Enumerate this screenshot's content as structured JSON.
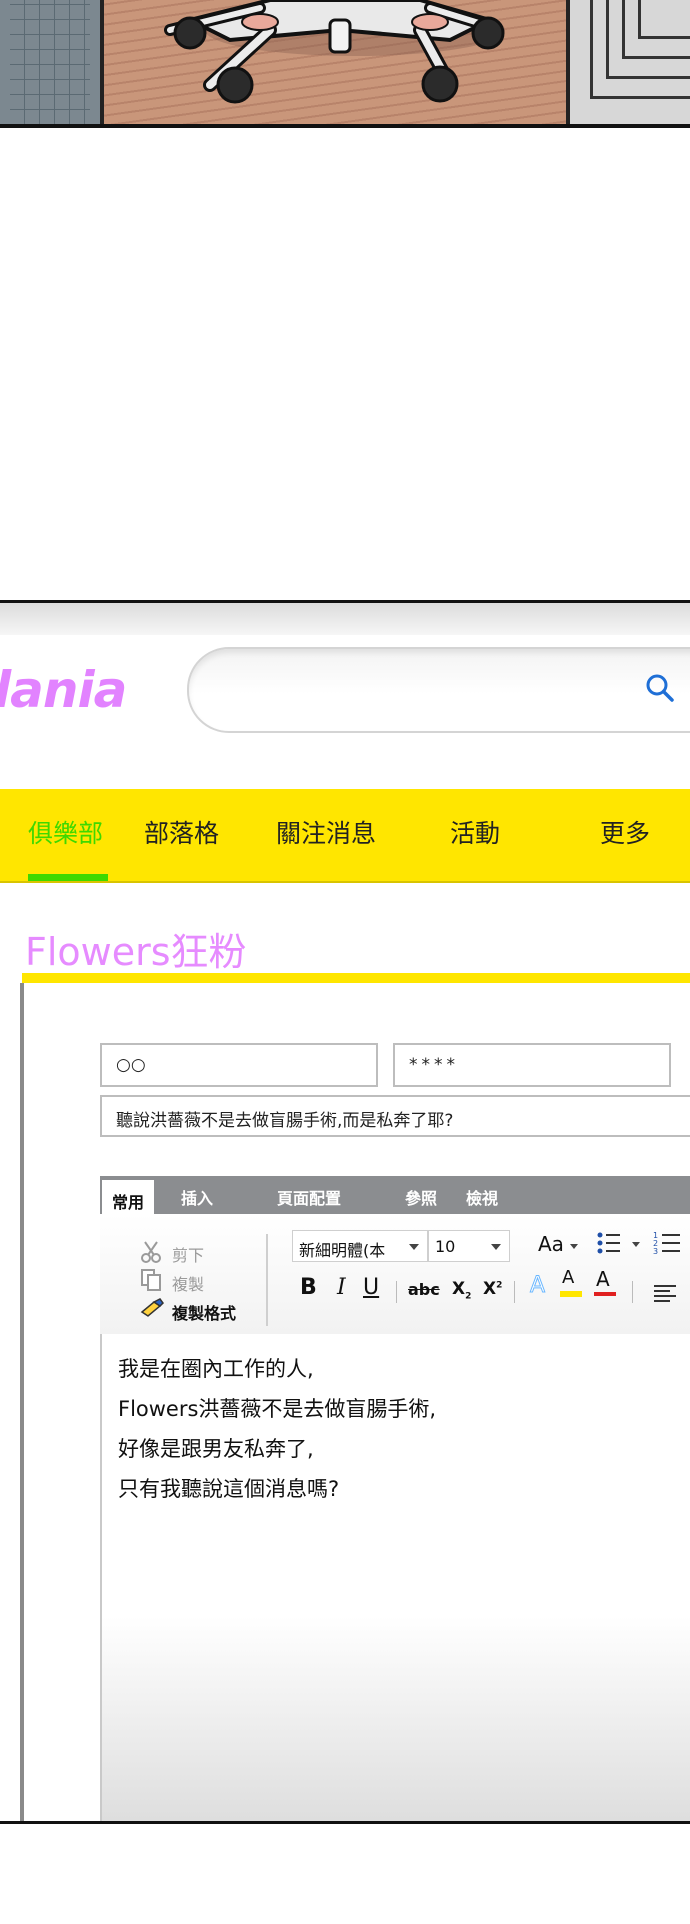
{
  "site": {
    "logo_text": "lania",
    "search_placeholder": ""
  },
  "nav": {
    "items": [
      {
        "label": "俱樂部",
        "active": true
      },
      {
        "label": "部落格",
        "active": false
      },
      {
        "label": "關注消息",
        "active": false
      },
      {
        "label": "活動",
        "active": false
      },
      {
        "label": "更多",
        "active": false
      }
    ]
  },
  "club": {
    "title": "Flowers狂粉"
  },
  "form": {
    "name_value": "○○",
    "password_value": "****",
    "subject_value": "聽說洪薔薇不是去做盲腸手術,而是私奔了耶?"
  },
  "editor": {
    "tabs": [
      "常用",
      "插入",
      "頁面配置",
      "參照",
      "檢視"
    ],
    "clipboard": {
      "cut": "剪下",
      "copy": "複製",
      "format_painter": "複製格式"
    },
    "font_name": "新細明體(本",
    "font_size": "10",
    "grow_font": "Aa",
    "format": {
      "bold": "B",
      "italic": "I",
      "underline": "U",
      "strike": "abc",
      "subscript": "X",
      "superscript": "X"
    },
    "highlight_letter": "A",
    "font_color_letter": "A",
    "colors": {
      "highlight": "#ffe600",
      "font_color": "#e02020",
      "text_effect": "#6ab7ff"
    },
    "body_lines": [
      "我是在圈內工作的人,",
      "Flowers洪薔薇不是去做盲腸手術,",
      "好像是跟男友私奔了,",
      "只有我聽說這個消息嗎?"
    ]
  },
  "colors": {
    "nav_bg": "#ffe600",
    "nav_active": "#3ed900",
    "logo": "#e283ff",
    "title": "#e68bff"
  }
}
